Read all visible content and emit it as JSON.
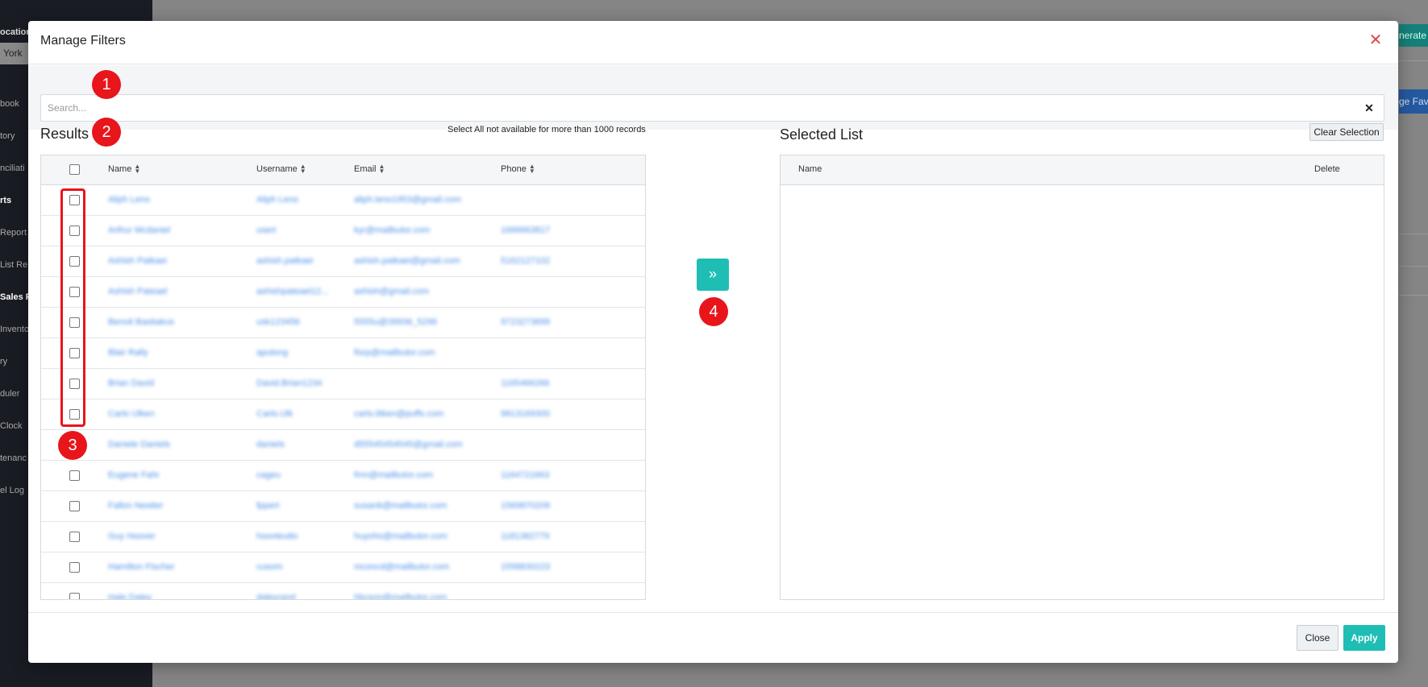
{
  "background": {
    "location_label": "ocation:",
    "location_value": "York",
    "nav_items": [
      {
        "label": "book",
        "active": false
      },
      {
        "label": "tory",
        "active": false
      },
      {
        "label": "nciliati",
        "active": false
      },
      {
        "label": "rts",
        "active": true
      },
      {
        "label": "Report",
        "active": false
      },
      {
        "label": "List Re",
        "active": false
      },
      {
        "label": "Sales F",
        "active": true
      },
      {
        "label": "Invento",
        "active": false
      },
      {
        "label": "ry",
        "active": false
      },
      {
        "label": "duler",
        "active": false
      },
      {
        "label": "Clock",
        "active": false
      },
      {
        "label": "tenanc",
        "active": false
      },
      {
        "label": "el Log",
        "active": false
      }
    ],
    "generate_label": "nerate",
    "fav_label": "ge Favo"
  },
  "modal": {
    "title": "Manage Filters",
    "close_icon": "close-icon",
    "search": {
      "placeholder": "Search...",
      "value": "",
      "clear_icon": "clear-icon"
    },
    "results": {
      "title": "Results",
      "note": "Select All not available for more than 1000 records",
      "columns": [
        "Name",
        "Username",
        "Email",
        "Phone"
      ],
      "rows": [
        {
          "name": "Aliph Leno",
          "username": "Aliph Leno",
          "email": "aliph.leno1953@gmail.com",
          "phone": ""
        },
        {
          "name": "Arthur Mcdaniel",
          "username": "usert",
          "email": "kyr@mailbutor.com",
          "phone": "1666663817"
        },
        {
          "name": "Ashish Patkaei",
          "username": "ashish.patkaei",
          "email": "ashish.patkaei@gmail.com",
          "phone": "5162127102"
        },
        {
          "name": "Ashish Pateael",
          "username": "ashishpateael12...",
          "email": "ashish@gmail.com",
          "phone": ""
        },
        {
          "name": "Benoit Bastiakus",
          "username": "usk123456",
          "email": "5555u@39936_5296",
          "phone": "9723273899"
        },
        {
          "name": "Blair Rally",
          "username": "apulong",
          "email": "fisrp@mailbutor.com",
          "phone": ""
        },
        {
          "name": "Brian David",
          "username": "David.Brian1234",
          "email": "",
          "phone": "1165466266"
        },
        {
          "name": "Carlo Ulken",
          "username": "Carlo.Ulk",
          "email": "carlo.litken@puffs.com",
          "phone": "9813169300"
        },
        {
          "name": "Daniele Daniels",
          "username": "daniels",
          "email": "d55545454545@gmail.com",
          "phone": ""
        },
        {
          "name": "Eugene Fahr",
          "username": "cageu",
          "email": "fmn@mailbutor.com",
          "phone": "1164721663"
        },
        {
          "name": "Fallon Nestter",
          "username": "fppert",
          "email": "susanb@mailbutor.com",
          "phone": "1569870209"
        },
        {
          "name": "Guy Hoover",
          "username": "hoovteutto",
          "email": "huyoho@mailbutor.com",
          "phone": "1181382779"
        },
        {
          "name": "Hamilton Fischer",
          "username": "cusom",
          "email": "mconcd@mailbutor.com",
          "phone": "1558830223"
        },
        {
          "name": "Hale Daley",
          "username": "daleyrand",
          "email": "hbcson@mailbutor.com",
          "phone": ""
        }
      ]
    },
    "move_button_icon": "double-chevron-right-icon",
    "selected": {
      "title": "Selected List",
      "clear_label": "Clear Selection",
      "columns": [
        "Name",
        "Delete"
      ]
    },
    "footer": {
      "close_label": "Close",
      "apply_label": "Apply"
    }
  },
  "annotations": {
    "badge_1": "1",
    "badge_2": "2",
    "badge_3": "3",
    "badge_4": "4",
    "color": "#e8151b"
  },
  "colors": {
    "accent": "#1ebeb4",
    "close_red": "#e04545",
    "link_blue": "#4a8fe7"
  }
}
